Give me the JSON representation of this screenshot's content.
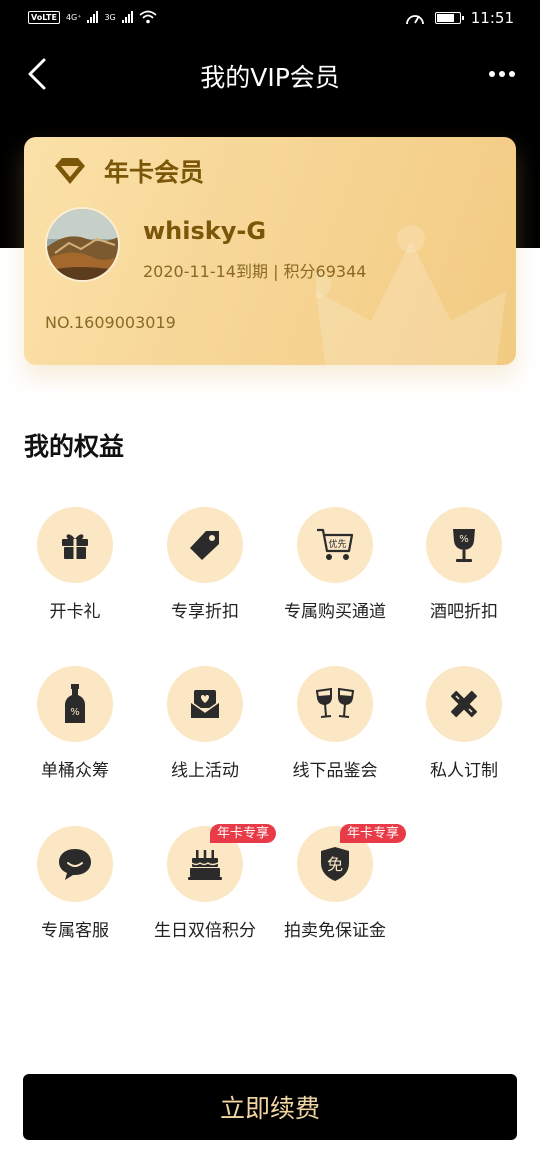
{
  "status": {
    "volte": "VoLTE",
    "net1": "4G⁺",
    "net2": "3G",
    "time": "11:51"
  },
  "nav": {
    "title": "我的VIP会员"
  },
  "card": {
    "level": "年卡会员",
    "username": "whisky-G",
    "meta": "2020-11-14到期 | 积分69344",
    "number": "NO.1609003019"
  },
  "benefits_title": "我的权益",
  "benefits": [
    {
      "label": "开卡礼",
      "icon": "gift-icon"
    },
    {
      "label": "专享折扣",
      "icon": "price-tag-icon"
    },
    {
      "label": "专属购买通道",
      "icon": "shopping-cart-icon",
      "icon_text": "优先"
    },
    {
      "label": "酒吧折扣",
      "icon": "wine-glass-icon"
    },
    {
      "label": "单桶众筹",
      "icon": "bottle-icon"
    },
    {
      "label": "线上活动",
      "icon": "mail-heart-icon"
    },
    {
      "label": "线下品鉴会",
      "icon": "cheers-icon"
    },
    {
      "label": "私人订制",
      "icon": "pencil-ruler-icon"
    },
    {
      "label": "专属客服",
      "icon": "chat-bubble-icon"
    },
    {
      "label": "生日双倍积分",
      "icon": "birthday-cake-icon",
      "tag": "年卡专享"
    },
    {
      "label": "拍卖免保证金",
      "icon": "shield-icon",
      "icon_text": "免",
      "tag": "年卡专享"
    }
  ],
  "renew_label": "立即续费",
  "colors": {
    "accent": "#7a5608",
    "card": "#f6d493",
    "icon_bg": "#fbe7c4",
    "tag": "#e83a47",
    "button": "#000000",
    "button_text": "#f3d7a3"
  }
}
